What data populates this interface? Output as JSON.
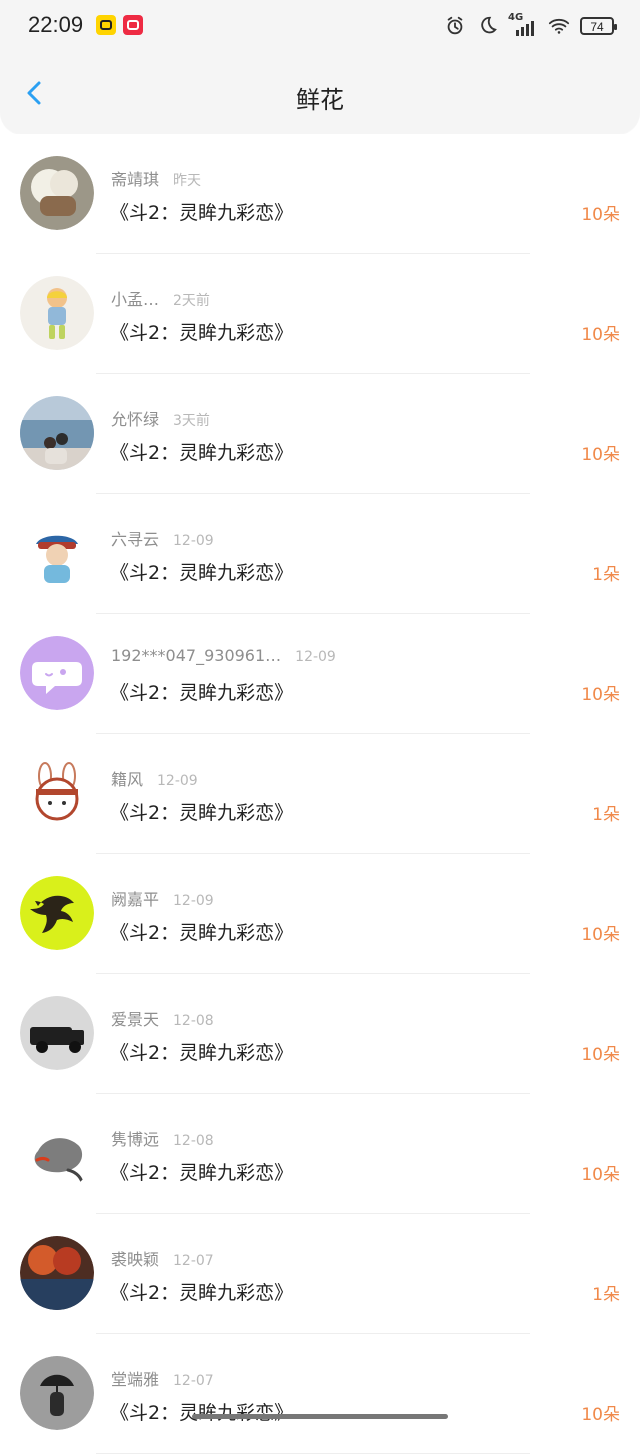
{
  "status_bar": {
    "time": "22:09",
    "battery": "74",
    "signal": "4G",
    "icons": [
      "yellow-app-icon",
      "red-app-icon",
      "alarm-icon",
      "moon-icon",
      "signal-icon",
      "wifi-icon",
      "battery-icon"
    ]
  },
  "header": {
    "title": "鲜花",
    "back_icon": "chevron-left-icon",
    "accent": "#2ba0f2"
  },
  "list": {
    "count_color": "#f0894a",
    "items": [
      {
        "name": "斋靖琪",
        "time": "昨天",
        "book": "《斗2：灵眸九彩恋》",
        "count": "10朵",
        "avatar": "flower-bouquet"
      },
      {
        "name": "小孟…",
        "time": "2天前",
        "book": "《斗2：灵眸九彩恋》",
        "count": "10朵",
        "avatar": "cartoon-girl"
      },
      {
        "name": "允怀绿",
        "time": "3天前",
        "book": "《斗2：灵眸九彩恋》",
        "count": "10朵",
        "avatar": "seaside-couple"
      },
      {
        "name": "六寻云",
        "time": "12-09",
        "book": "《斗2：灵眸九彩恋》",
        "count": "1朵",
        "avatar": "qing-official"
      },
      {
        "name": "192***047_930961…",
        "time": "12-09",
        "book": "《斗2：灵眸九彩恋》",
        "count": "10朵",
        "avatar": "chat-bubble"
      },
      {
        "name": "籍风",
        "time": "12-09",
        "book": "《斗2：灵眸九彩恋》",
        "count": "1朵",
        "avatar": "rabbit"
      },
      {
        "name": "阙嘉平",
        "time": "12-09",
        "book": "《斗2：灵眸九彩恋》",
        "count": "10朵",
        "avatar": "insect-yellow"
      },
      {
        "name": "爱景天",
        "time": "12-08",
        "book": "《斗2：灵眸九彩恋》",
        "count": "10朵",
        "avatar": "vintage-car"
      },
      {
        "name": "隽博远",
        "time": "12-08",
        "book": "《斗2：灵眸九彩恋》",
        "count": "10朵",
        "avatar": "cat-drawing"
      },
      {
        "name": "裘映颖",
        "time": "12-07",
        "book": "《斗2：灵眸九彩恋》",
        "count": "1朵",
        "avatar": "autumn-lake"
      },
      {
        "name": "堂端雅",
        "time": "12-07",
        "book": "《斗2：灵眸九彩恋》",
        "count": "10朵",
        "avatar": "umbrella-person"
      }
    ]
  }
}
